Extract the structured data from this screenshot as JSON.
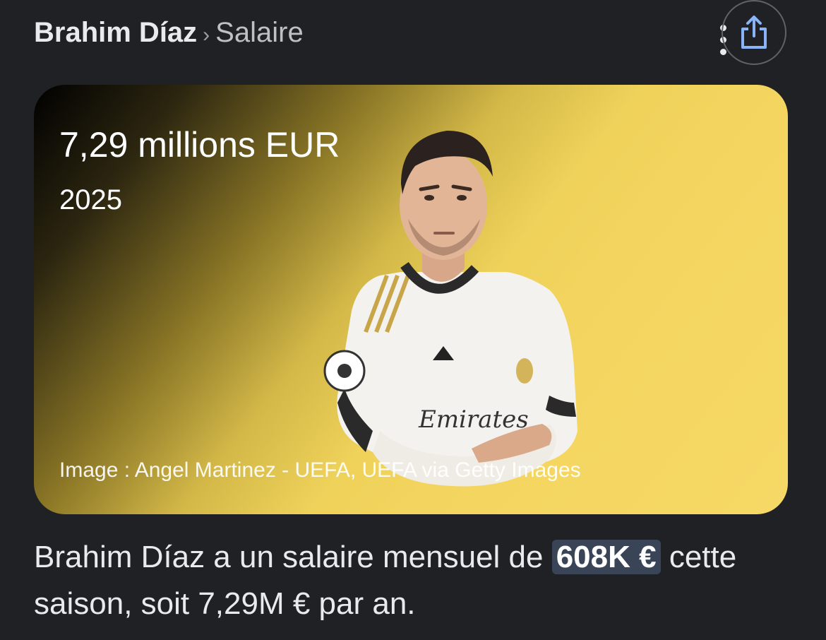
{
  "breadcrumb": {
    "main": "Brahim Díaz",
    "separator": "›",
    "sub": "Salaire"
  },
  "header": {
    "more_icon": "more-vert-icon",
    "share_icon": "share-icon"
  },
  "card": {
    "value": "7,29 millions EUR",
    "year": "2025",
    "credit": "Image : Angel Martinez - UEFA, UEFA via Getty Images",
    "jersey_text": "Emirates"
  },
  "description": {
    "prefix": "Brahim Díaz a un salaire mensuel de ",
    "highlight": "608K €",
    "suffix": " cette saison, soit 7,29M € par an."
  },
  "colors": {
    "background": "#202124",
    "highlight_bg": "#394457",
    "card_yellow": "#f4d560",
    "share_icon": "#8ab4f8"
  }
}
